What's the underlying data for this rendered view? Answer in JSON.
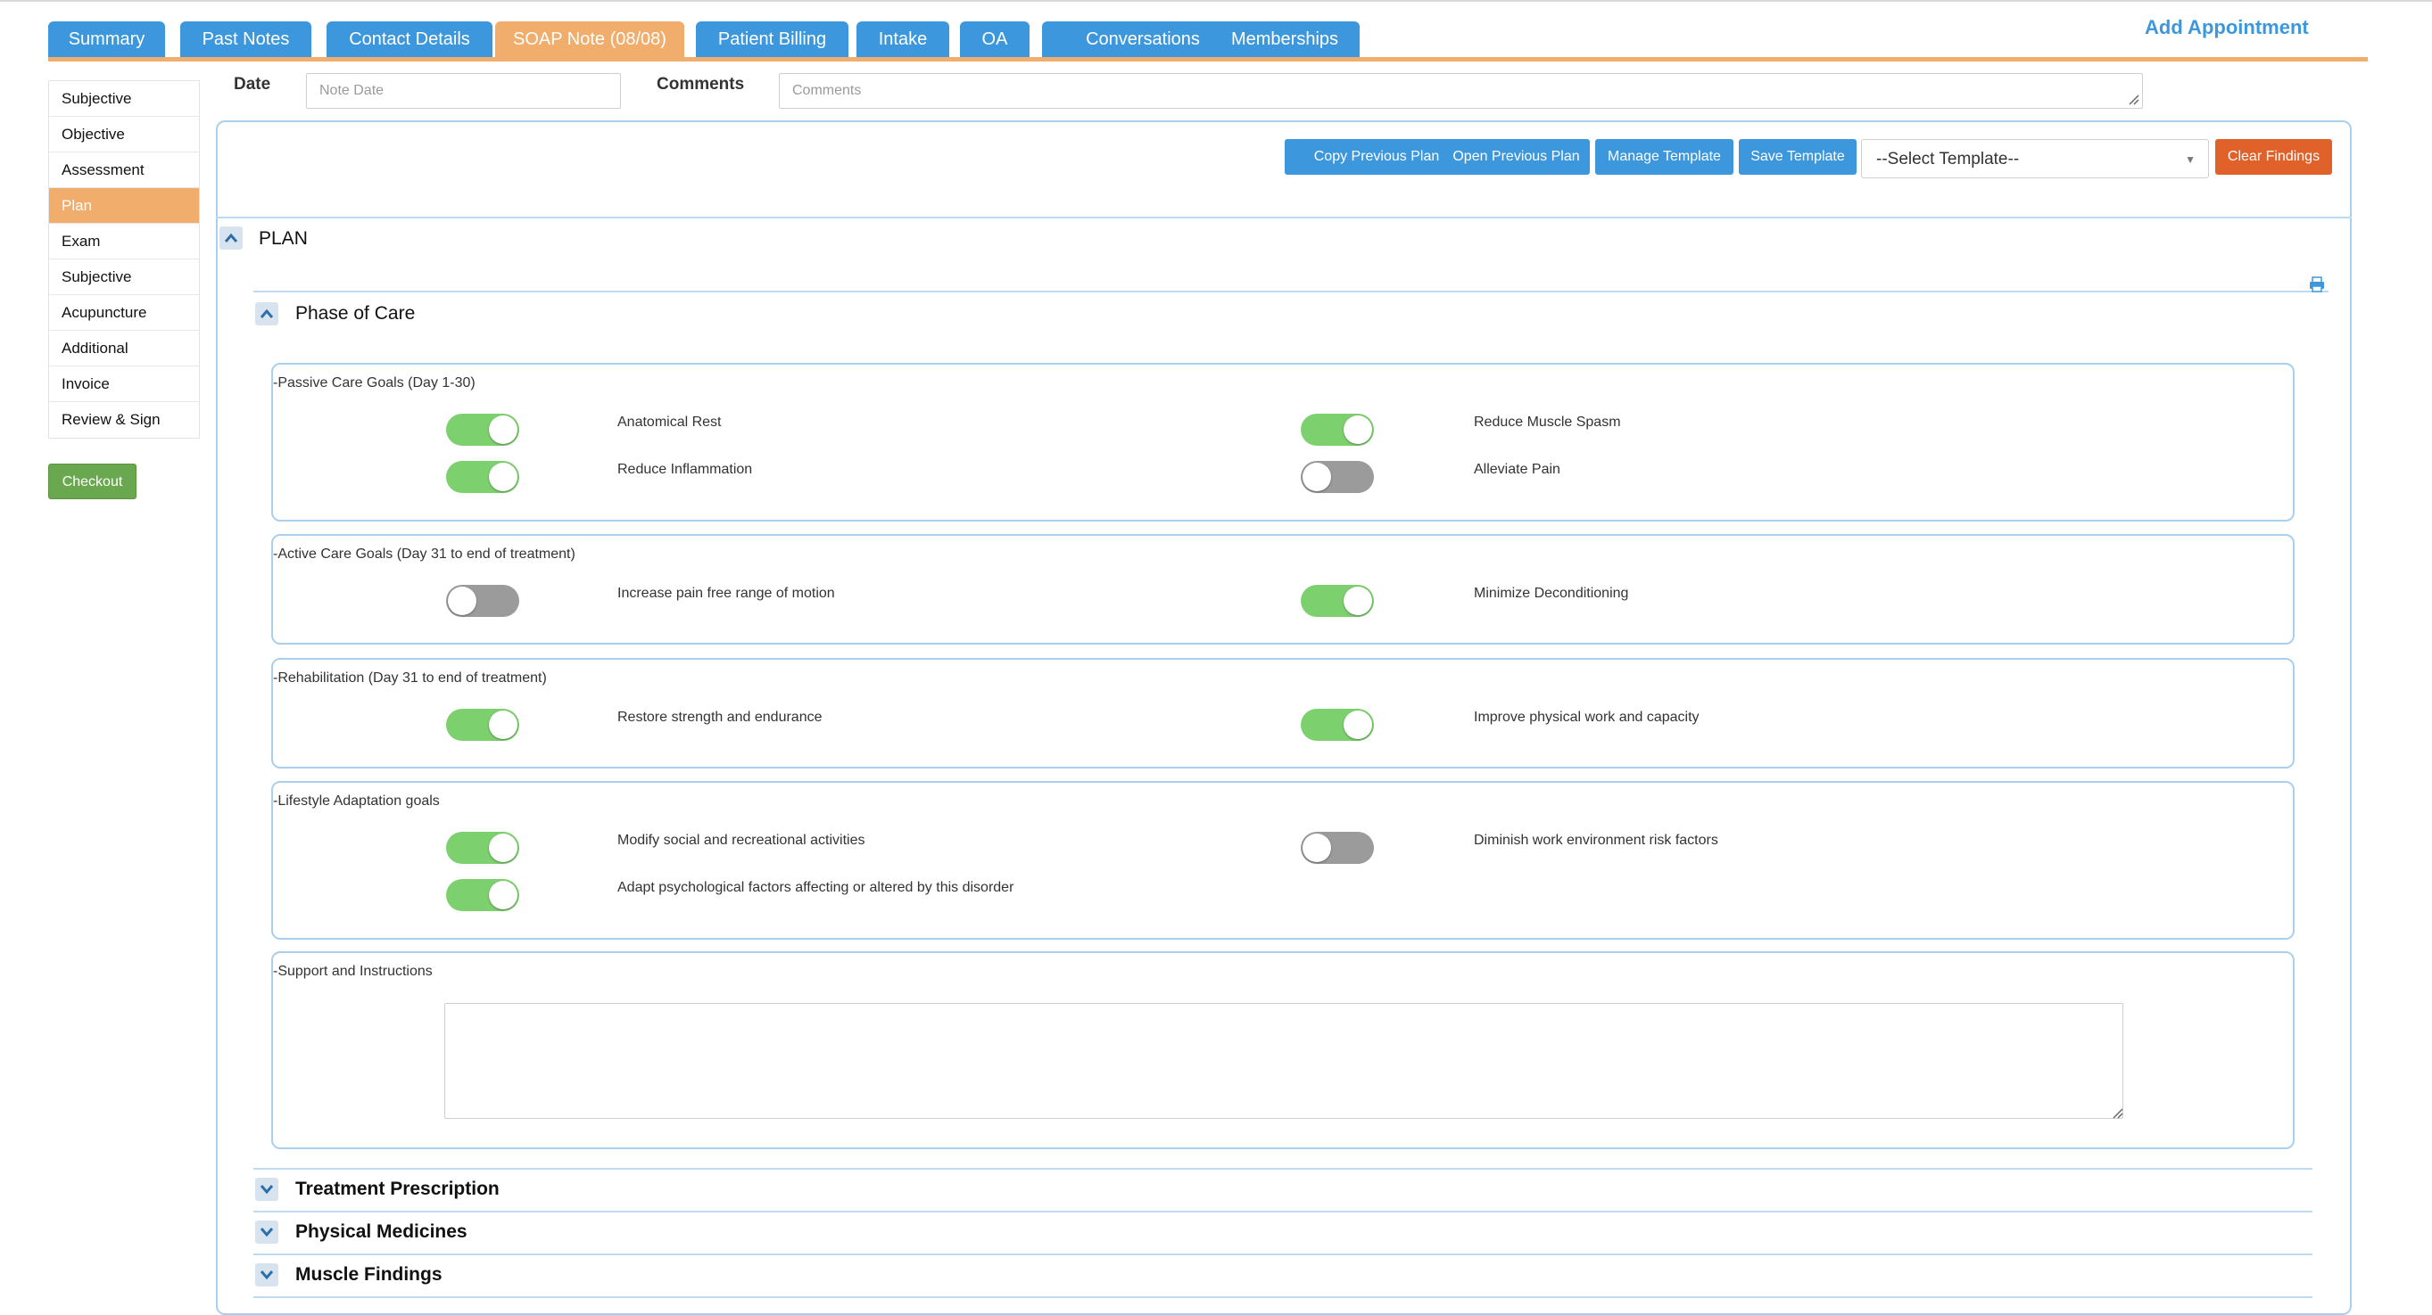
{
  "tabs": [
    {
      "label": "Summary",
      "active": false
    },
    {
      "label": "Past Notes",
      "active": false
    },
    {
      "label": "Contact Details",
      "active": false
    },
    {
      "label": "SOAP Note (08/08)",
      "active": true
    },
    {
      "label": "Patient Billing",
      "active": false
    },
    {
      "label": "Intake",
      "active": false
    },
    {
      "label": "OA",
      "active": false
    },
    {
      "label": "Conversations",
      "active": false
    },
    {
      "label": "Memberships",
      "active": false
    }
  ],
  "add_appointment_label": "Add Appointment",
  "sidebar": {
    "items": [
      {
        "label": "Subjective",
        "active": false
      },
      {
        "label": "Objective",
        "active": false
      },
      {
        "label": "Assessment",
        "active": false
      },
      {
        "label": "Plan",
        "active": true
      },
      {
        "label": "Exam",
        "active": false
      },
      {
        "label": "Subjective",
        "active": false
      },
      {
        "label": "Acupuncture",
        "active": false
      },
      {
        "label": "Additional",
        "active": false
      },
      {
        "label": "Invoice",
        "active": false
      },
      {
        "label": "Review & Sign",
        "active": false
      }
    ],
    "checkout_label": "Checkout"
  },
  "note": {
    "date_label": "Date",
    "date_placeholder": "Note Date",
    "date_value": "",
    "comments_label": "Comments",
    "comments_placeholder": "Comments",
    "comments_value": ""
  },
  "toolbar": {
    "copy_previous_plan": "Copy Previous Plan",
    "open_previous_plan": "Open Previous Plan",
    "manage_template": "Manage Template",
    "save_template": "Save Template",
    "select_template": "--Select Template--",
    "clear_findings": "Clear Findings"
  },
  "plan": {
    "title": "PLAN",
    "phase_of_care": {
      "title": "Phase of Care",
      "groups": [
        {
          "title": "-Passive Care Goals (Day 1-30)",
          "items": [
            {
              "label": "Anatomical Rest",
              "on": true
            },
            {
              "label": "Reduce Muscle Spasm",
              "on": true
            },
            {
              "label": "Reduce Inflammation",
              "on": true
            },
            {
              "label": "Alleviate Pain",
              "on": false
            }
          ]
        },
        {
          "title": "-Active Care Goals (Day 31 to end of treatment)",
          "items": [
            {
              "label": "Increase pain free range of motion",
              "on": false
            },
            {
              "label": "Minimize Deconditioning",
              "on": true
            }
          ]
        },
        {
          "title": "-Rehabilitation (Day 31 to end of treatment)",
          "items": [
            {
              "label": "Restore strength and endurance",
              "on": true
            },
            {
              "label": "Improve physical work and capacity",
              "on": true
            }
          ]
        },
        {
          "title": "-Lifestyle Adaptation goals",
          "items": [
            {
              "label": "Modify social and recreational activities",
              "on": true
            },
            {
              "label": "Diminish work environment risk factors",
              "on": false
            },
            {
              "label": "Adapt psychological factors affecting or altered by this disorder",
              "on": true
            }
          ]
        }
      ],
      "support_title": "-Support and Instructions",
      "support_value": ""
    },
    "collapsed_sections": [
      "Treatment Prescription",
      "Physical Medicines",
      "Muscle Findings"
    ]
  },
  "icons": {
    "expand": "chevron-up-icon",
    "collapse": "chevron-down-icon",
    "print": "print-icon"
  },
  "colors": {
    "tab_blue": "#3d97dc",
    "tab_active": "#f0ad6c",
    "toggle_on": "#7dd06e",
    "toggle_off": "#9b9b9b",
    "clear_findings": "#e0622a",
    "checkout_green": "#6aa84f"
  }
}
